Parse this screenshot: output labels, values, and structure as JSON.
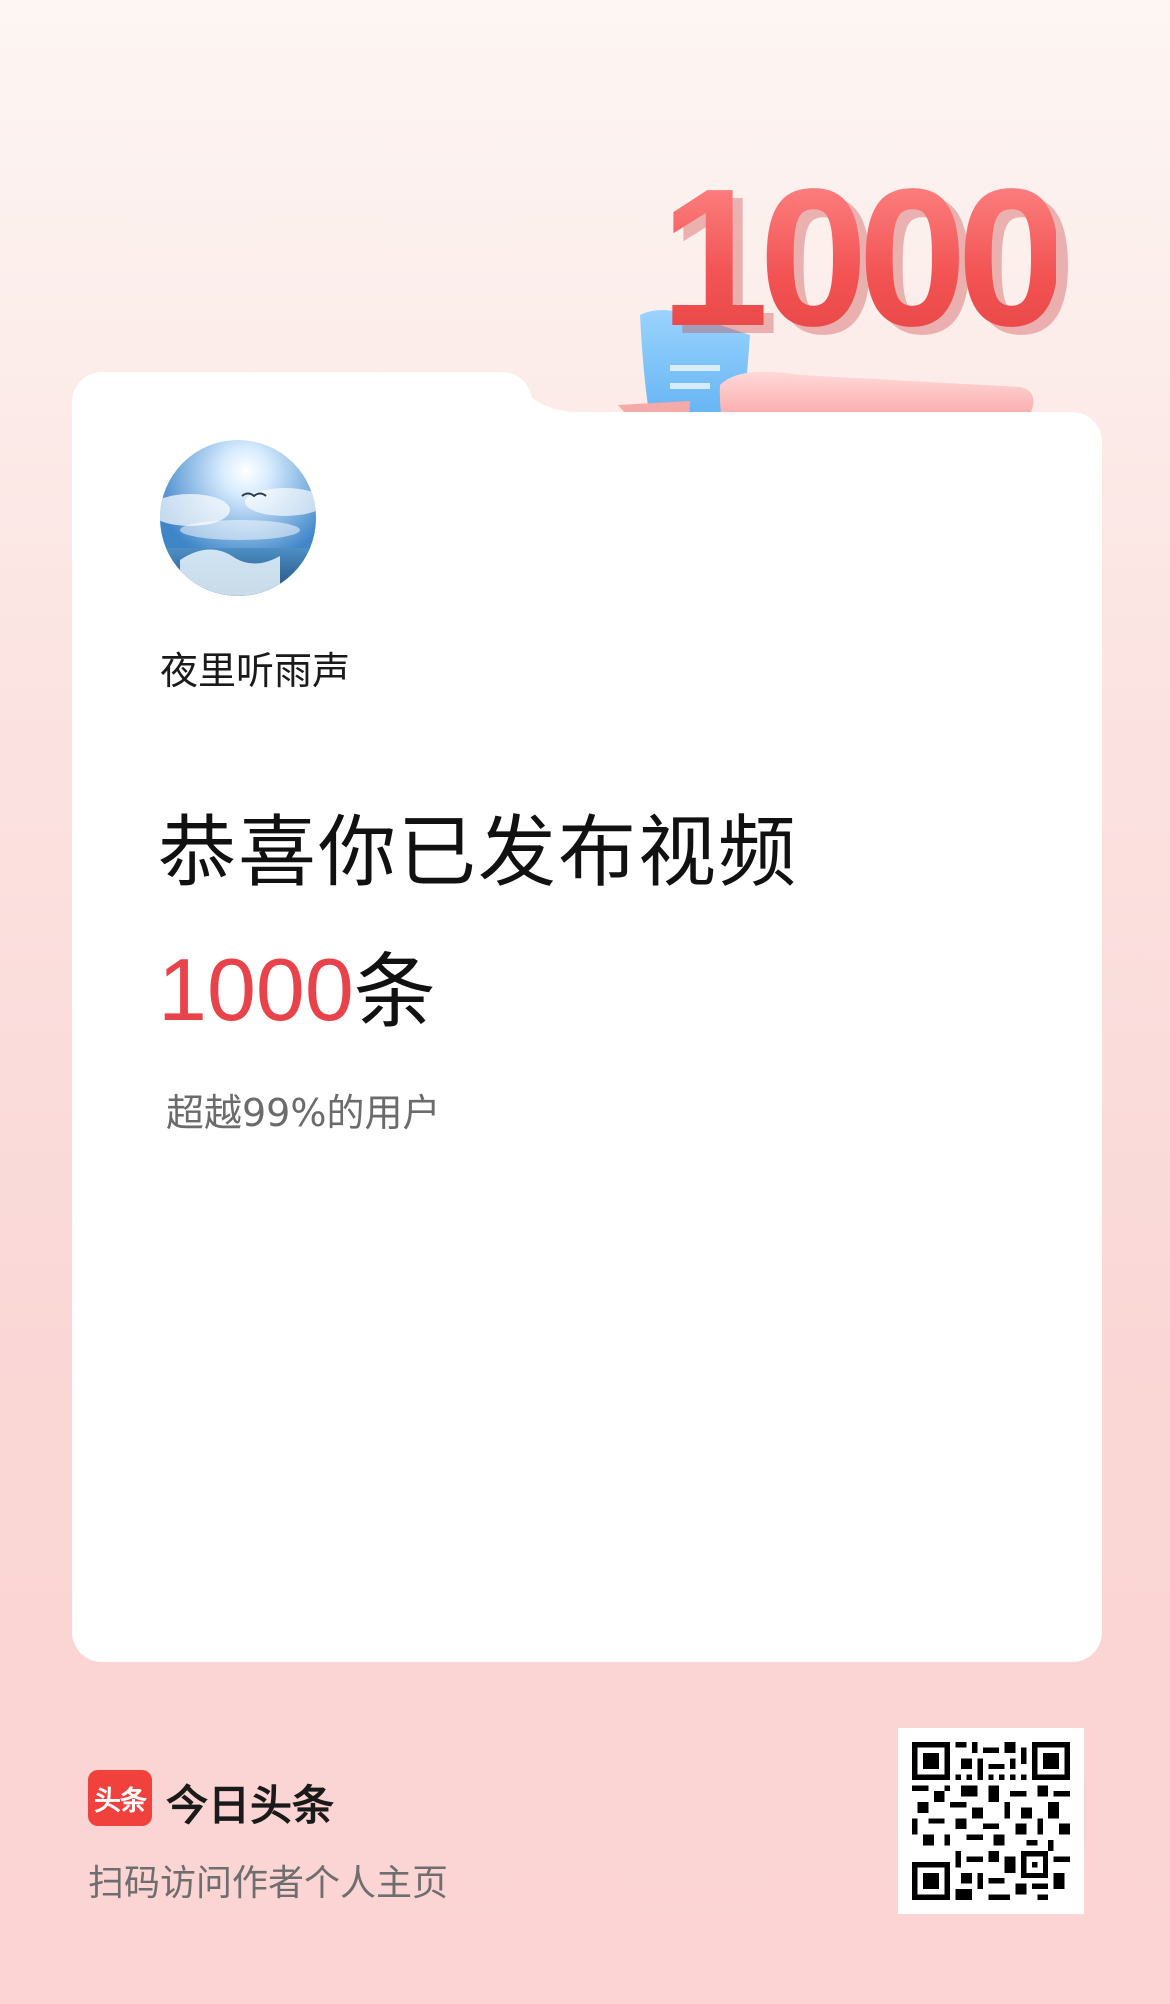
{
  "badge": {
    "number": "1000"
  },
  "profile": {
    "username": "夜里听雨声"
  },
  "headline": {
    "line1": "恭喜你已发布视频",
    "count": "1000",
    "unit": "条"
  },
  "rank": {
    "text": "超越99%的用户"
  },
  "footer": {
    "logo_text": "头条",
    "brand_name": "今日头条",
    "caption": "扫码访问作者个人主页"
  },
  "colors": {
    "accent": "#e8434b",
    "brand_red": "#f0413c",
    "background_top": "#fdf6f3",
    "background_bottom": "#fbd4d3"
  },
  "icons": {
    "avatar": "ocean-sky-avatar",
    "qr": "qr-code-icon",
    "badge": "milestone-badge-icon"
  }
}
